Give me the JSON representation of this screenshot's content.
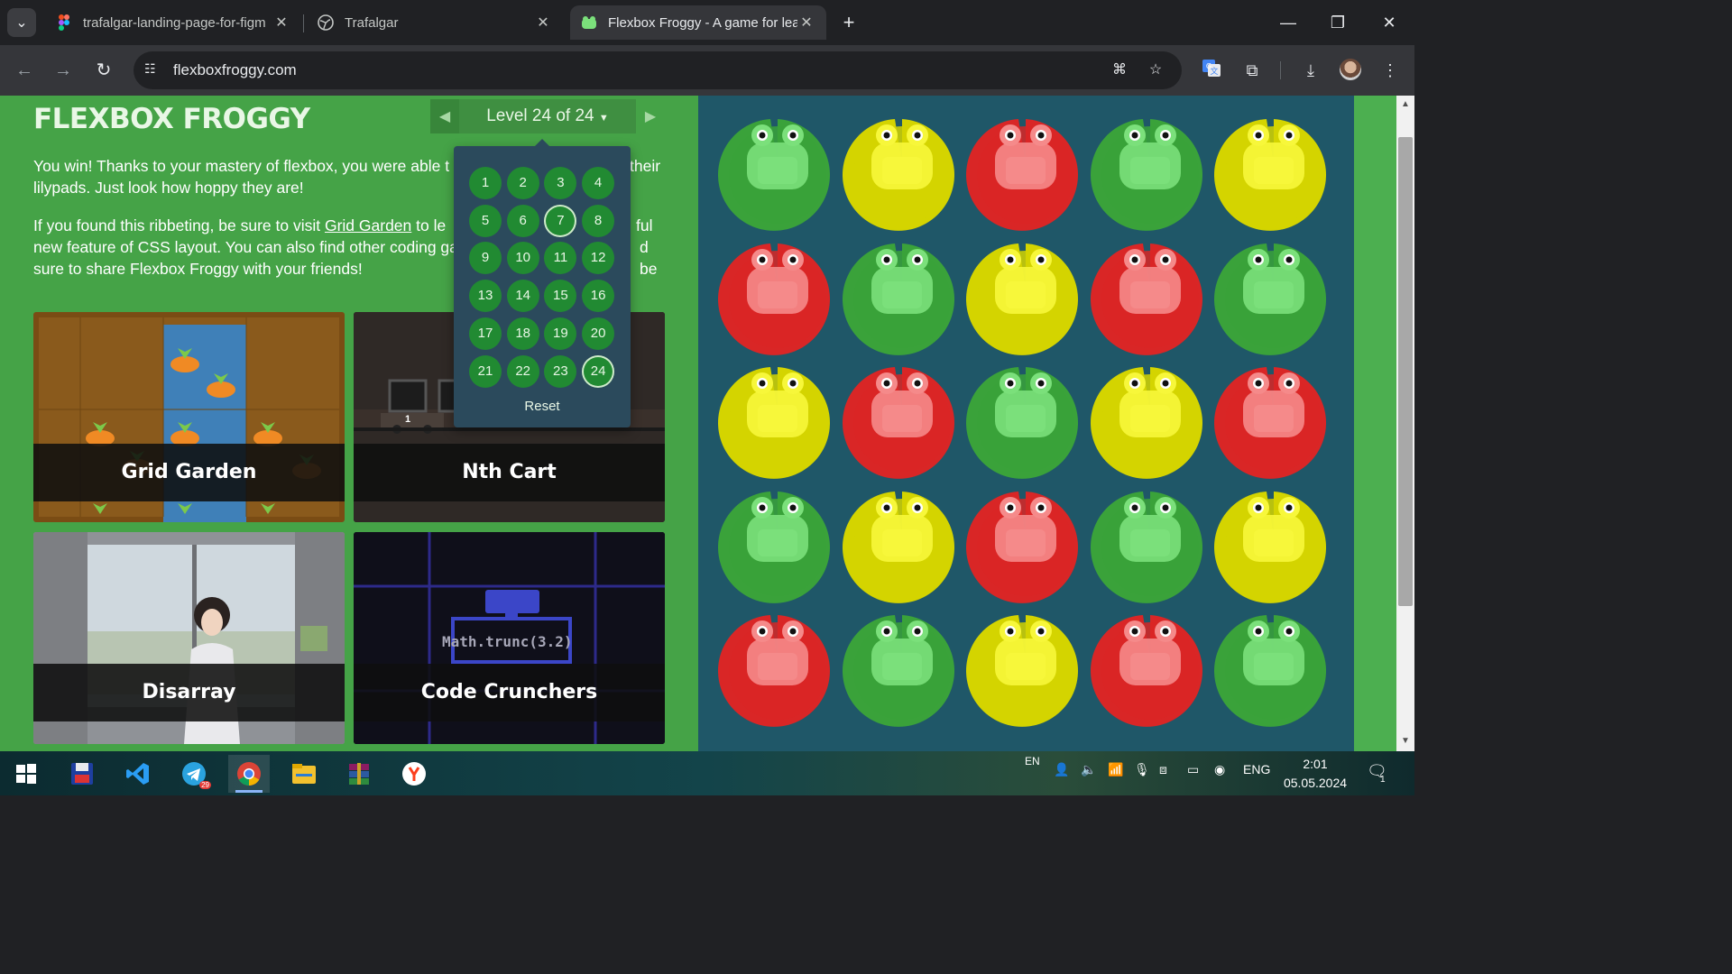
{
  "browser": {
    "tabs": [
      {
        "title": "trafalgar-landing-page-for-figm",
        "active": false,
        "favicon": "figma-icon"
      },
      {
        "title": "Trafalgar",
        "active": false,
        "favicon": "globe-icon"
      },
      {
        "title": "Flexbox Froggy - A game for lea",
        "active": true,
        "favicon": "frog-icon"
      }
    ],
    "url": "flexboxfroggy.com"
  },
  "game": {
    "logo": "FLEXBOX FROGGY",
    "level_label": "Level 24 of 24",
    "intro_p1": "You win! Thanks to your mastery of flexbox, you were able t",
    "intro_p1b": "their",
    "intro_p1c": "lilypads. Just look how hoppy they are!",
    "intro_p2a": "If you found this ribbeting, be sure to visit ",
    "intro_p2_link": "Grid Garden",
    "intro_p2b": " to le",
    "intro_p2c": "ful",
    "intro_p2d": "new feature of CSS layout. You can also find other coding ga",
    "intro_p2e": "d be",
    "intro_p2f": "sure to share Flexbox Froggy with your friends!",
    "cards": [
      {
        "title": "Grid Garden"
      },
      {
        "title": "Nth Cart"
      },
      {
        "title": "Disarray"
      },
      {
        "title": "Code Crunchers"
      }
    ],
    "code_crunchers_expr": "Math.trunc(3.2)",
    "nth_cart_number": "1",
    "levels": [
      "1",
      "2",
      "3",
      "4",
      "5",
      "6",
      "7",
      "8",
      "9",
      "10",
      "11",
      "12",
      "13",
      "14",
      "15",
      "16",
      "17",
      "18",
      "19",
      "20",
      "21",
      "22",
      "23",
      "24"
    ],
    "reset_label": "Reset",
    "board_colors": [
      [
        "green",
        "yellow",
        "red",
        "green",
        "yellow"
      ],
      [
        "red",
        "green",
        "yellow",
        "red",
        "green"
      ],
      [
        "yellow",
        "red",
        "green",
        "yellow",
        "red"
      ],
      [
        "green",
        "yellow",
        "red",
        "green",
        "yellow"
      ],
      [
        "red",
        "green",
        "yellow",
        "red",
        "green"
      ]
    ]
  },
  "taskbar": {
    "lang_top": "EN",
    "lang": "ENG",
    "time": "2:01",
    "date": "05.05.2024",
    "notifications": "1",
    "telegram_badge": "29"
  },
  "colors": {
    "green_pad": "#3aa23a",
    "green_frog": "#7be07b",
    "yellow_pad": "#d4d400",
    "yellow_frog": "#f7f73a",
    "red_pad": "#d92626",
    "red_frog": "#f58a8a",
    "board_bg": "#1f5768"
  }
}
